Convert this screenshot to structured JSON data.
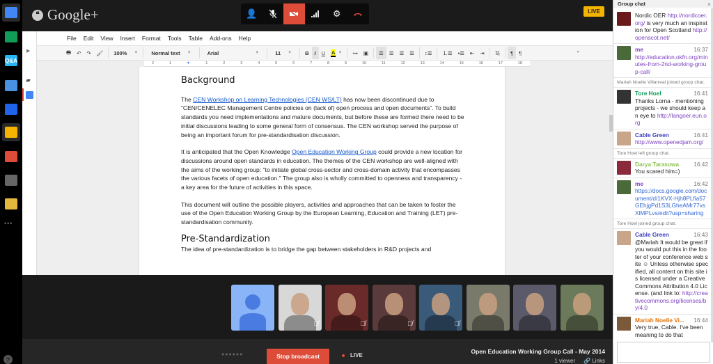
{
  "app": {
    "brand": "Google+",
    "live_badge": "LIVE"
  },
  "rail": {
    "icons": [
      {
        "name": "chat-app-icon",
        "label": "",
        "color": "#4285f4",
        "active": true
      },
      {
        "name": "screenshare-app-icon",
        "label": "",
        "color": "#0f9d58",
        "active": false
      },
      {
        "name": "qa-app-icon",
        "label": "Q&A",
        "color": "#29b6f6",
        "active": false
      },
      {
        "name": "capture-app-icon",
        "label": "",
        "color": "#4a90e2",
        "active": false
      },
      {
        "name": "effects-app-icon",
        "label": "",
        "color": "#1e63e9",
        "active": false
      },
      {
        "name": "drive-app-icon",
        "label": "",
        "color": "#f4b400",
        "active": true
      },
      {
        "name": "toolbox-app-icon",
        "label": "",
        "color": "#dd4b39",
        "active": false
      },
      {
        "name": "control-room-app-icon",
        "label": "",
        "color": "#666666",
        "active": false
      },
      {
        "name": "cameraman-app-icon",
        "label": "",
        "color": "#e3b73c",
        "active": false
      }
    ],
    "more": "•••",
    "help": "?"
  },
  "call_controls": {
    "invite": "invite-people-icon",
    "mute_mic": "mic-muted-icon",
    "camera_off": "camera-off-icon",
    "bandwidth": "bandwidth-icon",
    "settings": "settings-icon",
    "hang_up": "hang-up-icon"
  },
  "docs": {
    "menu": [
      "File",
      "Edit",
      "View",
      "Insert",
      "Format",
      "Tools",
      "Table",
      "Add-ons",
      "Help"
    ],
    "toolbar": {
      "zoom": "100%",
      "style": "Normal text",
      "font": "Arial",
      "size": "11",
      "bold": "B",
      "italic": "I",
      "underline": "U",
      "text_color": "A"
    },
    "ruler": [
      "2",
      "1",
      "",
      "1",
      "2",
      "3",
      "4",
      "5",
      "6",
      "7",
      "8",
      "9",
      "10",
      "11",
      "12",
      "13",
      "14",
      "15",
      "16",
      "17",
      "18"
    ],
    "document": {
      "heading1": "Background",
      "p1_pre": "The ",
      "p1_link": "CEN Workshop on Learning Technologies (CEN WS/LT)",
      "p1_post": " has now been discontinued due to “CEN/CENELEC Management Centre policies on (lack of) open process and open documents”. To build standards you need implementations and mature documents, but before these are formed there need to be initial discussions leading to some general form of consensus. The CEN workshop served the purpose of being an important forum for pre-standardisation discussion.",
      "p2_pre": "It is anticipated that the Open Knowledge ",
      "p2_link": "Open Education Working Group",
      "p2_post": " could provide a new location for discussions around open standards in education. The themes of the CEN workshop are well-aligned with the aims of the working group: \"to initiate global cross-sector and cross-domain activity that encompasses the various facets of open education.\" The group also is wholly committed to openness and transparency - a key area for the future of activities in this space.",
      "p3": "This document will outline the possible players, activities and approaches that can be taken to foster the use of the Open Education Working Group by the European Learning, Education and Training (LET) pre-standardisation community.",
      "heading2": "Pre-Standardization",
      "p4": "The idea of pre-standardization is to bridge the gap between stakeholders in R&D projects and"
    }
  },
  "participants": [
    {
      "name": "participant-you",
      "muted": false,
      "color": "#8ab4f8"
    },
    {
      "name": "participant-cable-green",
      "muted": true,
      "color": "#d8d8d8"
    },
    {
      "name": "participant-darya",
      "muted": true,
      "color": "#6b2a2a"
    },
    {
      "name": "participant-4",
      "muted": true,
      "color": "#5a3a3a"
    },
    {
      "name": "participant-mariah",
      "muted": true,
      "color": "#3a5a7a"
    },
    {
      "name": "participant-6",
      "muted": false,
      "color": "#7a7a6a"
    },
    {
      "name": "participant-7",
      "muted": false,
      "color": "#5a5a6a"
    },
    {
      "name": "participant-8",
      "muted": false,
      "color": "#6a7a5a"
    }
  ],
  "broadcast": {
    "stop_label": "Stop broadcast",
    "live_label": "LIVE",
    "title": "Open Education Working Group Call - May 2014",
    "viewers": "1 viewer",
    "links": "Links"
  },
  "chat": {
    "title": "Group chat",
    "close": "×",
    "items": [
      {
        "type": "msg",
        "author": "",
        "time": "",
        "author_color": "#333",
        "avatar": "#6a1a1a",
        "text": "Nordic OER ",
        "link": "http://nordicoer.org/",
        "text2": " is very much an inspiration for Open Scotland ",
        "link2": "http://openscot.net/"
      },
      {
        "type": "msg",
        "author": "me",
        "time": "16:37",
        "author_color": "#7b3fbf",
        "avatar": "#4a6a3a",
        "text": "",
        "link": "http://education.okfn.org/minutes-from-2nd-working-group-call/",
        "text2": "",
        "link2": ""
      },
      {
        "type": "sys",
        "text": "Mariah Noelle Villarreal joined group chat."
      },
      {
        "type": "msg",
        "author": "Tore Hoel",
        "time": "16:41",
        "author_color": "#0f9d58",
        "avatar": "#333",
        "text": "Thanks Lorna - mentioning projects - we should keep an eye to ",
        "link": "http://langoer.eun.org",
        "text2": "",
        "link2": ""
      },
      {
        "type": "msg",
        "author": "Cable Green",
        "time": "16:41",
        "author_color": "#3b3bbf",
        "avatar": "#c9a58a",
        "text": "",
        "link": "http://www.openedjam.org/",
        "text2": "",
        "link2": ""
      },
      {
        "type": "sys",
        "text": "Tore Hoel left group chat."
      },
      {
        "type": "msg",
        "author": "Darya Tarasowa",
        "time": "16:42",
        "author_color": "#8bc34a",
        "avatar": "#8a2a3a",
        "text": "You scared him=)",
        "link": "",
        "text2": "",
        "link2": ""
      },
      {
        "type": "msg",
        "author": "me",
        "time": "16:42",
        "author_color": "#7b3fbf",
        "avatar": "#4a6a3a",
        "text": "",
        "link": "https://docs.google.com/document/d/1KVX-Hjh8PLfia57GEhjgPd1S3LGheAMr77vsXlMPLvs/edit?usp=sharing",
        "text2": "",
        "link2": ""
      },
      {
        "type": "sys",
        "text": "Tore Hoel joined group chat."
      },
      {
        "type": "msg",
        "author": "Cable Green",
        "time": "16:43",
        "author_color": "#3b3bbf",
        "avatar": "#c9a58a",
        "text": "@Mariah It would be great if you would put this in the footer of your conference web site ☺ Unless otherwise specified, all content on this site is licensed under a Creative Commons Attribution 4.0 License. (and link to: ",
        "link": "http://creativecommons.org/licenses/by/4.0",
        "text2": "",
        "link2": ""
      },
      {
        "type": "msg",
        "author": "Mariah Noelle Vi...",
        "time": "16:44",
        "author_color": "#e8710a",
        "avatar": "#7a5a3a",
        "text": "Very true, Cable. I've been meaning to do that",
        "link": "",
        "text2": "",
        "link2": ""
      }
    ],
    "input_placeholder": ""
  }
}
